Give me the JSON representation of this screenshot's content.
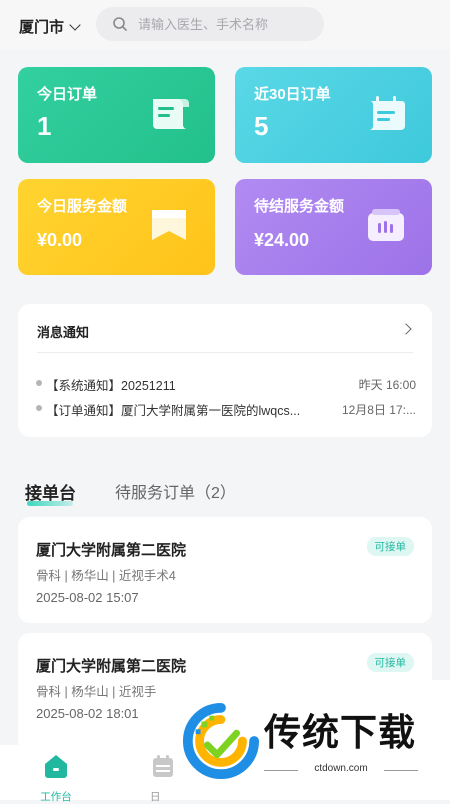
{
  "header": {
    "city": "厦门市",
    "search_placeholder": "请输入医生、手术名称"
  },
  "stats": [
    {
      "label": "今日订单",
      "value": "1",
      "icon": "document-scroll-icon"
    },
    {
      "label": "近30日订单",
      "value": "5",
      "icon": "calendar-list-icon"
    },
    {
      "label": "今日服务金额",
      "value": "¥0.00",
      "icon": "envelope-flag-icon"
    },
    {
      "label": "待结服务金额",
      "value": "¥24.00",
      "icon": "wallet-bars-icon"
    }
  ],
  "colors": {
    "green": "#22c08a",
    "cyan": "#3ec9dc",
    "yellow": "#ffc31a",
    "purple": "#9d72e8",
    "accent": "#22b8a0"
  },
  "notice": {
    "title": "消息通知",
    "items": [
      {
        "text": "【系统通知】20251211",
        "time": "昨天 16:00"
      },
      {
        "text": "【订单通知】厦门大学附属第一医院的lwqcs...",
        "time": "12月8日 17:..."
      }
    ]
  },
  "tabs": [
    {
      "label": "接单台",
      "active": true
    },
    {
      "label": "待服务订单（2）",
      "active": false
    }
  ],
  "orders": [
    {
      "hospital": "厦门大学附属第二医院",
      "badge": "可接单",
      "meta": "骨科 | 杨华山 | 近视手术4",
      "time": "2025-08-02 15:07"
    },
    {
      "hospital": "厦门大学附属第二医院",
      "badge": "可接单",
      "meta": "骨科 | 杨华山 | 近视手",
      "time": "2025-08-02 18:01"
    }
  ],
  "bottom_nav": [
    {
      "label": "工作台",
      "icon": "home-icon",
      "active": true
    },
    {
      "label": "日",
      "icon": "calendar-icon",
      "active": false
    }
  ],
  "watermark": {
    "text": "传统下载",
    "url": "ctdown.com"
  }
}
